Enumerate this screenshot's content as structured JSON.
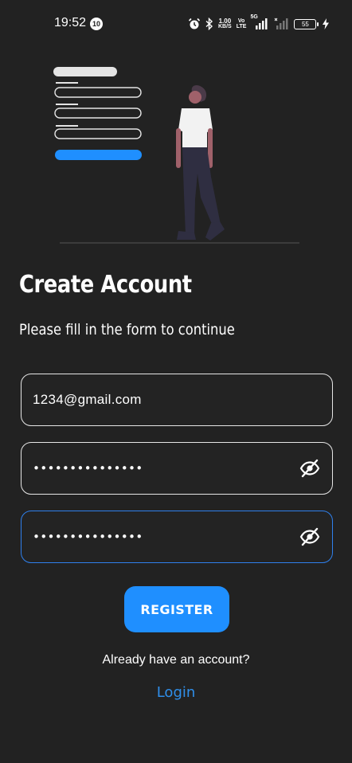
{
  "status_bar": {
    "time": "19:52",
    "notification_count": "10",
    "net_speed_value": "1.00",
    "net_speed_unit": "KB/S",
    "volte_top": "Vo",
    "volte_bottom": "LTE",
    "network_type": "5G",
    "battery_level": "55"
  },
  "page": {
    "title": "Create Account",
    "subtitle": "Please fill in the form to continue"
  },
  "form": {
    "email_value": "1234@gmail.com",
    "password_masked": "•••••••••••••••",
    "confirm_password_masked": "•••••••••••••••"
  },
  "actions": {
    "register_label": "REGISTER",
    "already_account_text": "Already have an account?",
    "login_label": "Login"
  },
  "colors": {
    "background": "#222222",
    "accent": "#1f8fff",
    "link": "#2f8fea",
    "focus_border": "#2f80ed"
  }
}
